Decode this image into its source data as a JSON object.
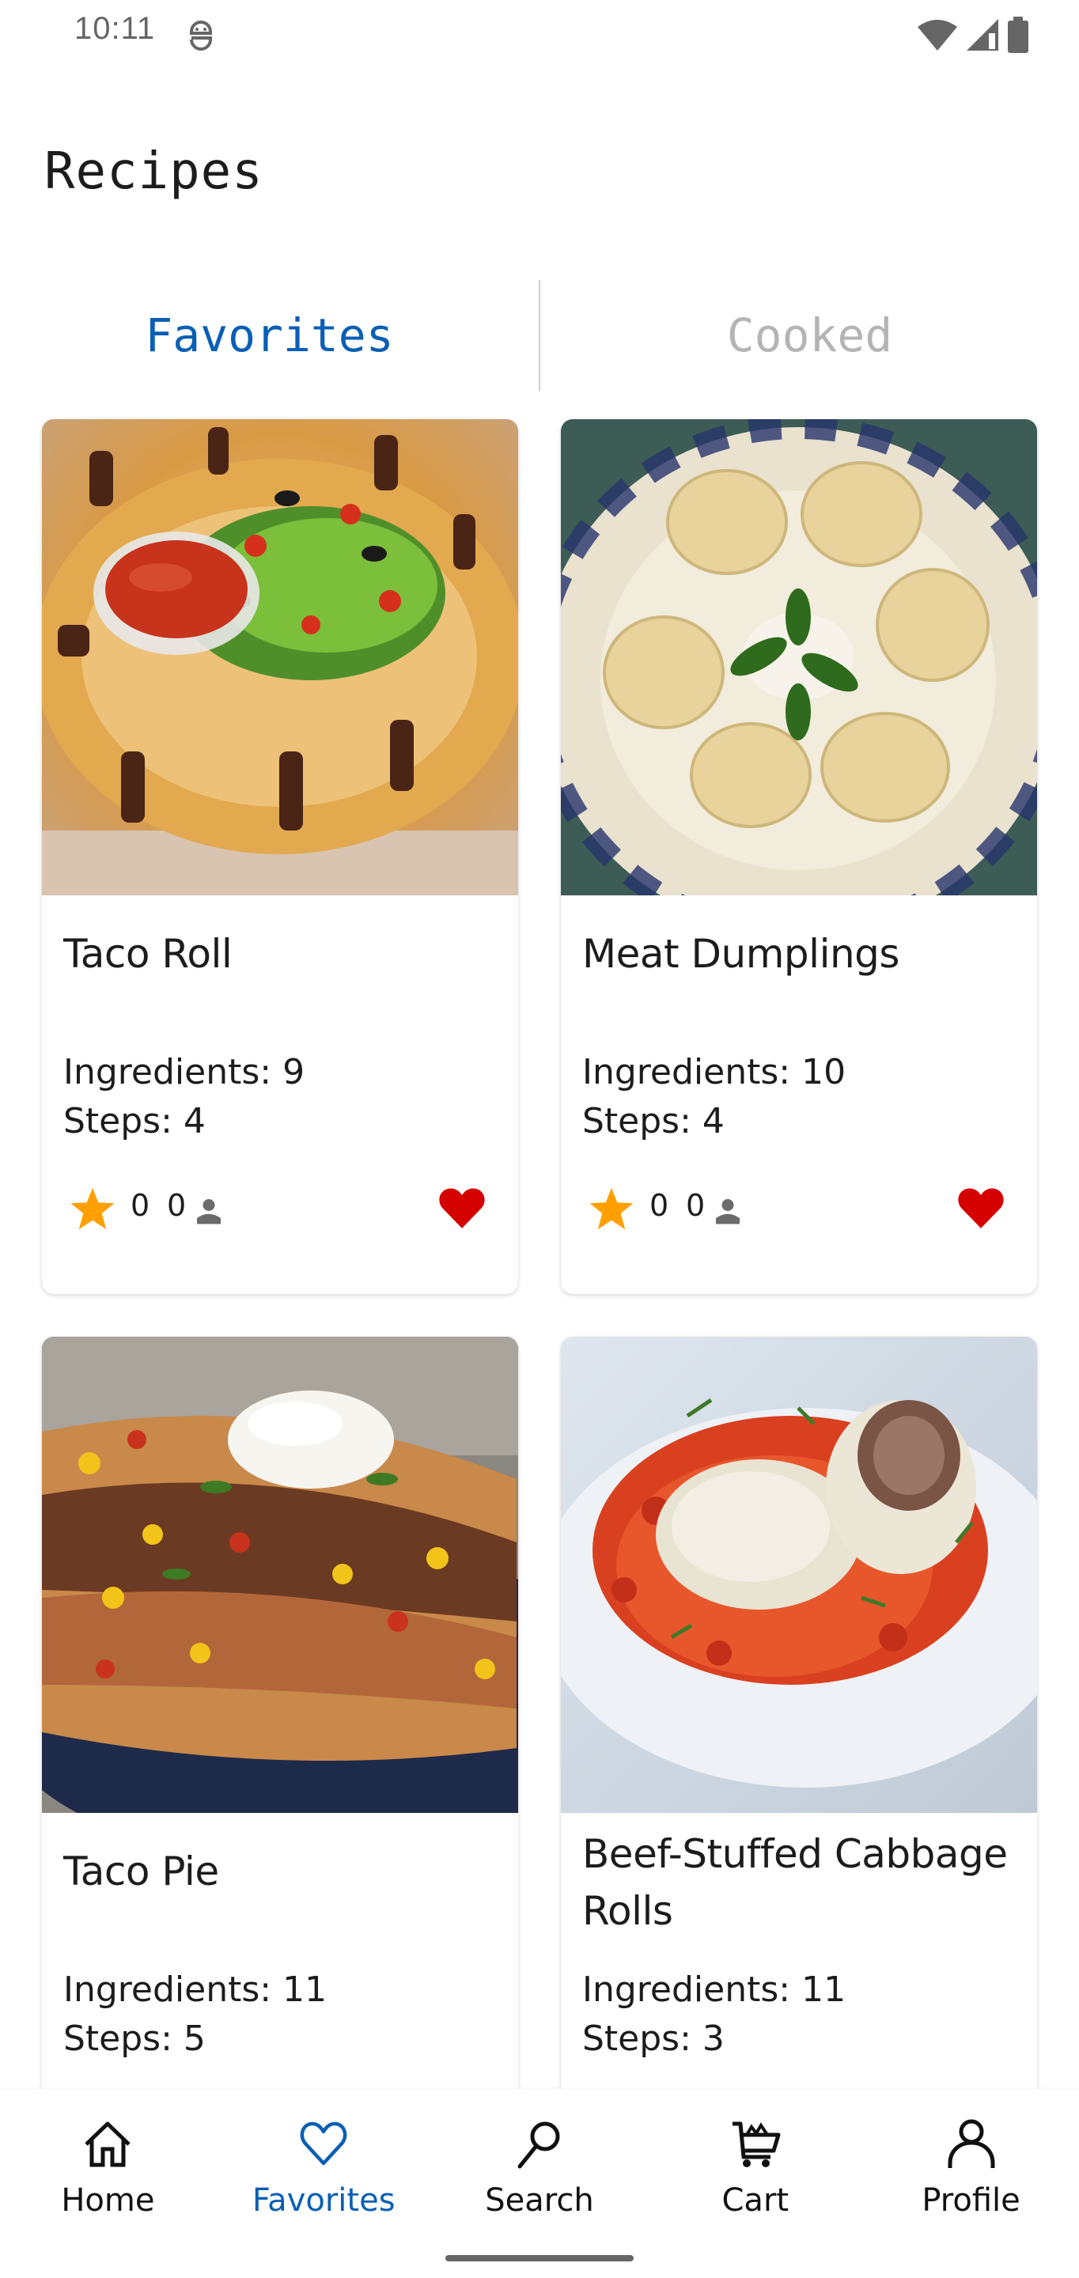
{
  "status_bar": {
    "time": "10:11",
    "left_icons": [
      "sim-notification-icon"
    ],
    "right_icons": [
      "wifi-icon",
      "cellular-signal-icon",
      "battery-icon"
    ]
  },
  "page": {
    "title": "Recipes"
  },
  "tabs": [
    {
      "label": "Favorites",
      "active": true
    },
    {
      "label": "Cooked",
      "active": false
    }
  ],
  "colors": {
    "accent": "#0a5fb4",
    "inactive_tab": "#b4b4b4",
    "favorite_heart": "#d50000",
    "rating_star": "#ffa000",
    "text": "#1c1c1c",
    "icon_gray": "#6b6b6b"
  },
  "recipes": [
    {
      "title": "Taco Roll",
      "ingredients_text": "Ingredients: 9",
      "steps_text": "Steps: 4",
      "rating": "0",
      "cooked_count": "0",
      "favorite": true,
      "image": "taco-roll-photo"
    },
    {
      "title": "Meat Dumplings",
      "ingredients_text": "Ingredients: 10",
      "steps_text": "Steps: 4",
      "rating": "0",
      "cooked_count": "0",
      "favorite": true,
      "image": "meat-dumplings-photo"
    },
    {
      "title": "Taco Pie",
      "ingredients_text": "Ingredients: 11",
      "steps_text": "Steps: 5",
      "image": "taco-pie-photo"
    },
    {
      "title": "Beef-Stuffed Cabbage Rolls",
      "ingredients_text": "Ingredients: 11",
      "steps_text": "Steps: 3",
      "image": "cabbage-rolls-photo"
    }
  ],
  "bottom_nav": [
    {
      "label": "Home",
      "icon": "home-icon",
      "active": false
    },
    {
      "label": "Favorites",
      "icon": "heart-outline-icon",
      "active": true
    },
    {
      "label": "Search",
      "icon": "search-icon",
      "active": false
    },
    {
      "label": "Cart",
      "icon": "cart-icon",
      "active": false
    },
    {
      "label": "Profile",
      "icon": "profile-icon",
      "active": false
    }
  ]
}
